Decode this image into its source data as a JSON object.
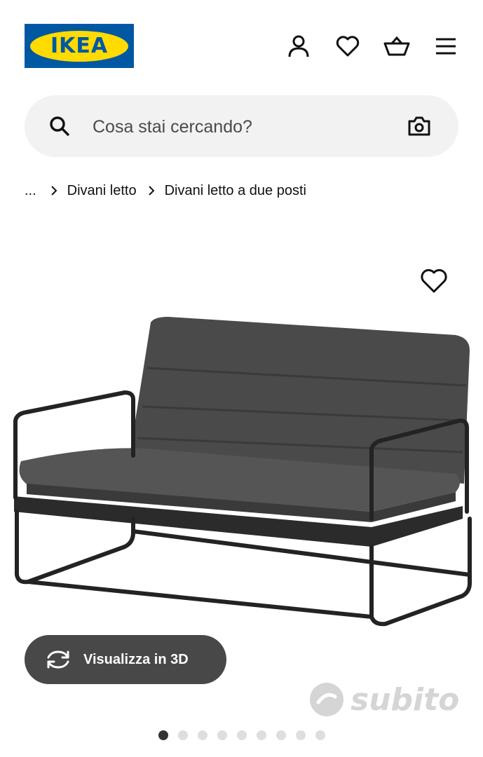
{
  "brand": {
    "logo_text": "IKEA",
    "colors": {
      "blue": "#0058a3",
      "yellow": "#ffdb00"
    }
  },
  "header": {
    "icons": [
      "user-icon",
      "heart-icon",
      "basket-icon",
      "menu-icon"
    ]
  },
  "search": {
    "placeholder": "Cosa stai cercando?",
    "icon": "search-icon",
    "visual_search_icon": "camera-icon"
  },
  "breadcrumb": {
    "ellipsis": "...",
    "items": [
      "Divani letto",
      "Divani letto a due posti"
    ]
  },
  "product": {
    "favorite_icon": "heart-icon"
  },
  "view3d": {
    "label": "Visualizza in 3D",
    "icon": "rotate-icon"
  },
  "watermark": {
    "text": "subito"
  },
  "carousel": {
    "total": 9,
    "active": 1
  }
}
